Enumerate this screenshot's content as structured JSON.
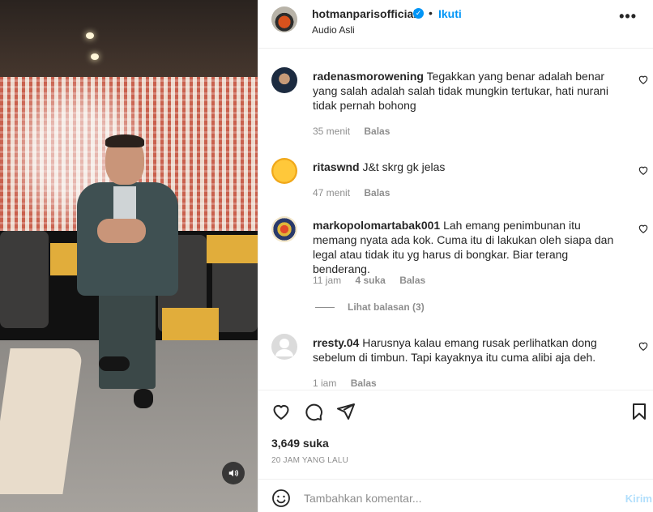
{
  "header": {
    "username": "hotmanparisofficial",
    "verified_mark": "✓",
    "separator": "•",
    "follow_label": "Ikuti",
    "audio_label": "Audio Asli",
    "more_icon": "more-horizontal-icon"
  },
  "comments": [
    {
      "username": "radenasmorowening",
      "text": "Tegakkan yang benar adalah benar yang salah adalah salah tidak mungkin tertukar, hati nurani tidak pernah bohong",
      "time": "35 menit",
      "likes": "",
      "reply_label": "Balas"
    },
    {
      "username": "ritaswnd",
      "text": "J&t skrg gk jelas",
      "time": "47 menit",
      "likes": "",
      "reply_label": "Balas"
    },
    {
      "username": "markopolomartabak001",
      "text": "Lah emang penimbunan itu memang nyata ada kok. Cuma itu di lakukan oleh siapa dan legal atau tidak itu yg harus di bongkar. Biar terang benderang.",
      "time": "11 jam",
      "likes": "4 suka",
      "reply_label": "Balas",
      "view_replies": "Lihat balasan (3)"
    },
    {
      "username": "rresty.04",
      "text": "Harusnya kalau emang rusak perlihatkan dong sebelum di timbun. Tapi kayaknya itu cuma alibi aja deh.",
      "time": "1 iam",
      "likes": "",
      "reply_label": "Balas"
    }
  ],
  "actions": {
    "likes": "3,649 suka",
    "timestamp": "20 JAM YANG LALU"
  },
  "add_comment": {
    "placeholder": "Tambahkan komentar...",
    "post_label": "Kirim"
  },
  "colors": {
    "accent": "#0095f6",
    "muted": "#8e8e8e",
    "text": "#262626"
  }
}
